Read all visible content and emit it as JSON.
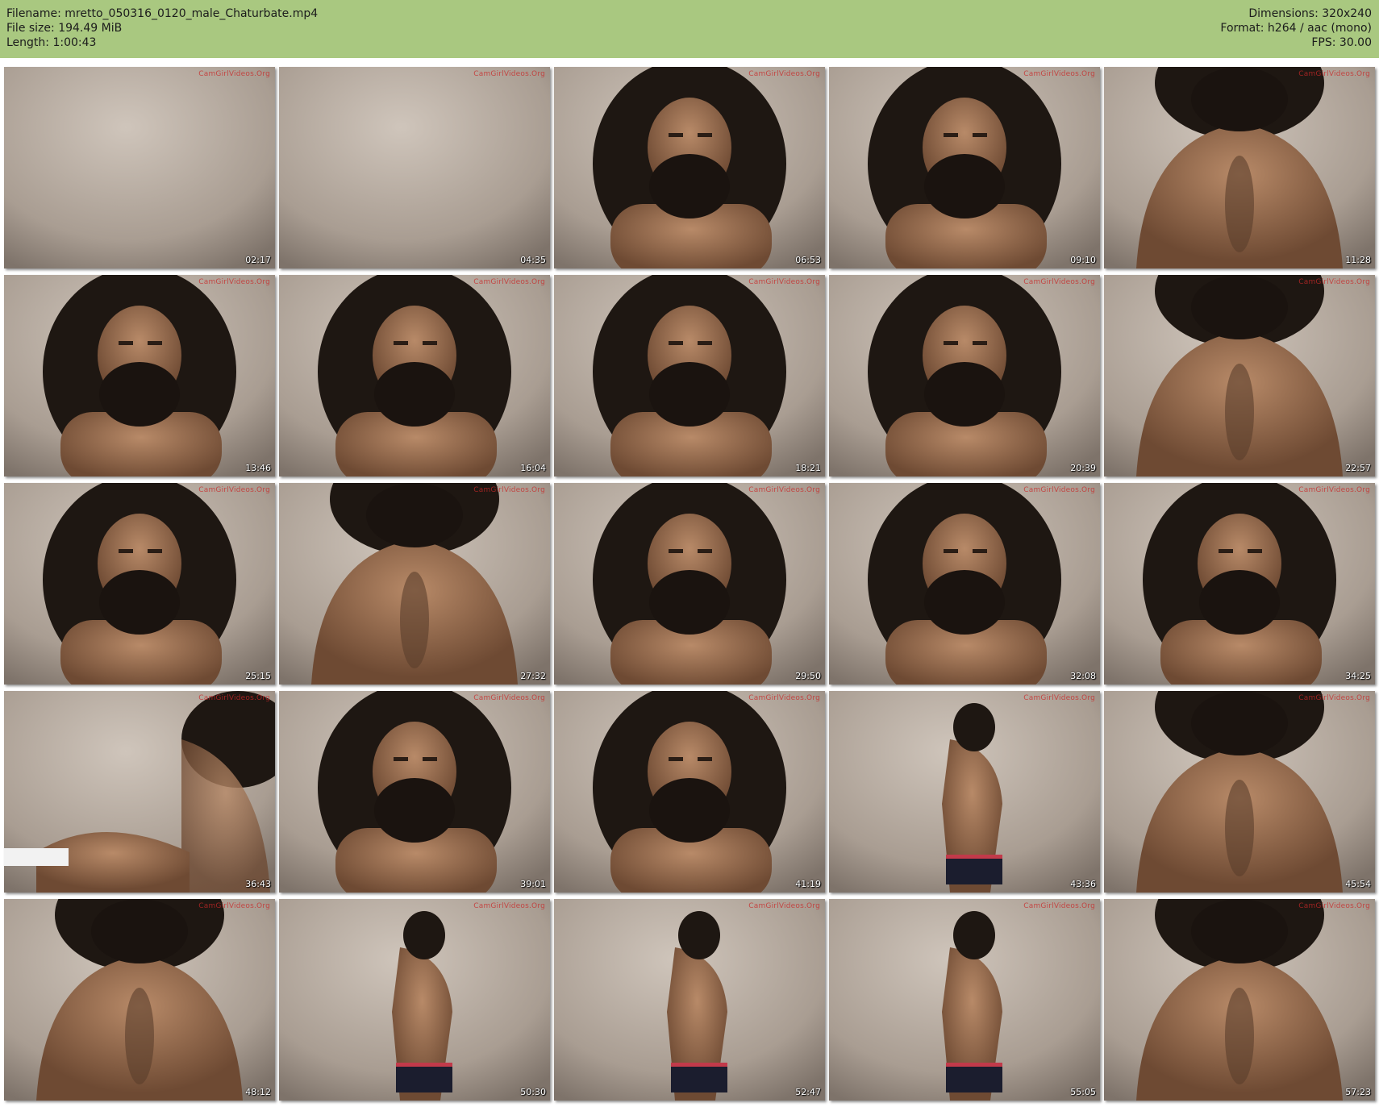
{
  "header": {
    "left": [
      "Filename: mretto_050316_0120_male_Chaturbate.mp4",
      "File size: 194.49 MiB",
      "Length: 1:00:43"
    ],
    "right": [
      "Dimensions: 320x240",
      "Format: h264 / aac (mono)",
      "FPS: 30.00"
    ]
  },
  "thumbnails": [
    {
      "time": "02:17",
      "scene": "wall"
    },
    {
      "time": "04:35",
      "scene": "wall"
    },
    {
      "time": "06:53",
      "scene": "face"
    },
    {
      "time": "09:10",
      "scene": "face"
    },
    {
      "time": "11:28",
      "scene": "torso"
    },
    {
      "time": "13:46",
      "scene": "face"
    },
    {
      "time": "16:04",
      "scene": "face"
    },
    {
      "time": "18:21",
      "scene": "face"
    },
    {
      "time": "20:39",
      "scene": "face"
    },
    {
      "time": "22:57",
      "scene": "torso"
    },
    {
      "time": "25:15",
      "scene": "face"
    },
    {
      "time": "27:32",
      "scene": "torso"
    },
    {
      "time": "29:50",
      "scene": "face"
    },
    {
      "time": "32:08",
      "scene": "face"
    },
    {
      "time": "34:25",
      "scene": "face"
    },
    {
      "time": "36:43",
      "scene": "hand"
    },
    {
      "time": "39:01",
      "scene": "face"
    },
    {
      "time": "41:19",
      "scene": "face"
    },
    {
      "time": "43:36",
      "scene": "standing"
    },
    {
      "time": "45:54",
      "scene": "torso"
    },
    {
      "time": "48:12",
      "scene": "torso"
    },
    {
      "time": "50:30",
      "scene": "standing"
    },
    {
      "time": "52:47",
      "scene": "standing"
    },
    {
      "time": "55:05",
      "scene": "standing"
    },
    {
      "time": "57:23",
      "scene": "torso"
    }
  ],
  "watermark": "CamGirlVideos.Org",
  "colors": {
    "header_bg": "#a9c880",
    "wall": "#b9aea4",
    "skin": "#9a6c4e",
    "hair": "#1e1712"
  }
}
